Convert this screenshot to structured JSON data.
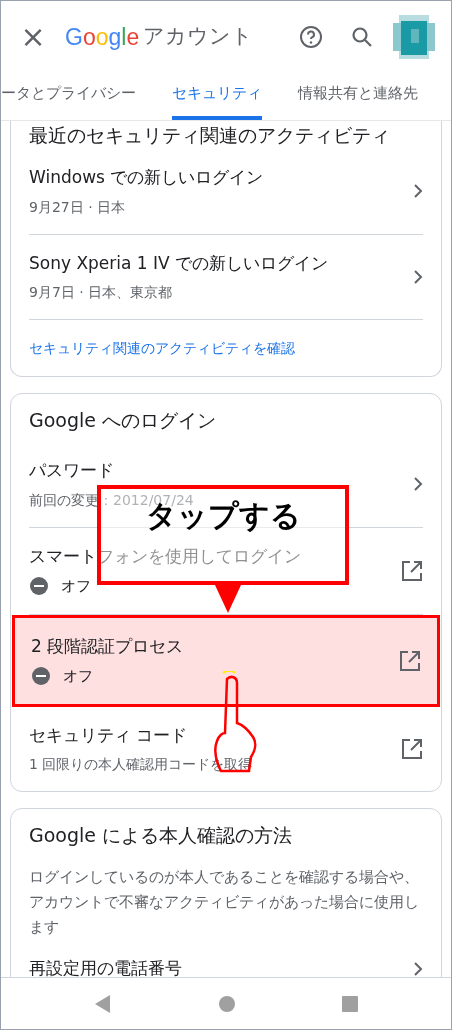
{
  "header": {
    "close": "×",
    "logo": "Google",
    "title": "アカウント"
  },
  "tabs": [
    {
      "label": "ータとプライバシー",
      "selected": false
    },
    {
      "label": "セキュリティ",
      "selected": true
    },
    {
      "label": "情報共有と連絡先",
      "selected": false
    }
  ],
  "cards": [
    {
      "title": "最近のセキュリティ関連のアクティビティ",
      "cut_top": true,
      "items": [
        {
          "kind": "chevron",
          "title": "Windows での新しいログイン",
          "subtitle": "9月27日 · 日本",
          "highlighted": false
        },
        {
          "kind": "chevron",
          "title": "Sony Xperia 1 IV での新しいログイン",
          "subtitle": "9月7日 · 日本、東京都",
          "highlighted": false
        }
      ],
      "link": "セキュリティ関連のアクティビティを確認"
    },
    {
      "title": "Google へのログイン",
      "cut_top": false,
      "items": [
        {
          "kind": "chevron",
          "title": "パスワード",
          "subtitle": "前回の変更：2012/07/24",
          "highlighted": false
        },
        {
          "kind": "external",
          "title": "スマートフォンを使用してログイン",
          "status": {
            "text": "オフ",
            "on": false
          },
          "highlighted": false
        },
        {
          "kind": "external",
          "title": "2 段階認証プロセス",
          "status": {
            "text": "オフ",
            "on": false
          },
          "highlighted": true
        },
        {
          "kind": "external",
          "title": "セキュリティ コード",
          "subtitle": "1 回限りの本人確認用コードを取得",
          "highlighted": false
        }
      ]
    },
    {
      "title": "Google による本人確認の方法",
      "cut_top": false,
      "description": "ログインしているのが本人であることを確認する場合や、アカウントで不審なアクティビティがあった場合に使用します",
      "items": [
        {
          "kind": "chevron",
          "title": "再設定用の電話番号",
          "highlighted": false
        }
      ]
    }
  ],
  "callout": {
    "text": "タップする"
  }
}
